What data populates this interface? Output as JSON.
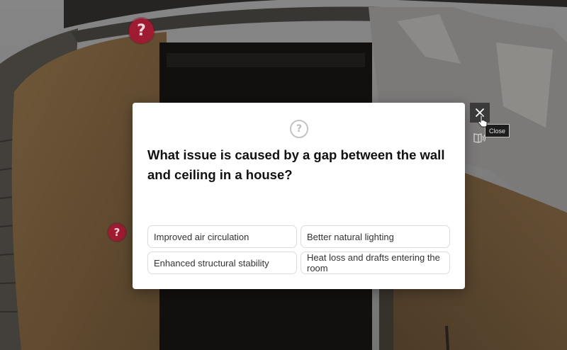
{
  "scene": {
    "hotspots": [
      {
        "symbol": "?"
      },
      {
        "symbol": "?"
      }
    ]
  },
  "modal": {
    "icon": "question-circle-icon",
    "icon_symbol": "?",
    "question": "What issue is caused by a gap between the wall and ceiling in a house?",
    "options": [
      "Improved air circulation",
      "Better natural lighting",
      "Enhanced structural stability",
      "Heat loss and drafts entering the room"
    ]
  },
  "controls": {
    "close_icon": "close-icon",
    "close_tooltip": "Close",
    "audio_icon": "audio-book-icon"
  },
  "colors": {
    "hotspot": "#9e1b32",
    "modal_bg": "#ffffff",
    "option_border": "#dcdcdc",
    "control_bg": "#3a3a3a"
  }
}
